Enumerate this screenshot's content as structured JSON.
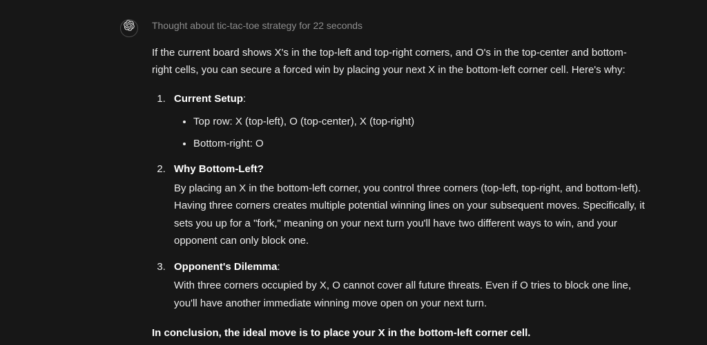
{
  "assistant": {
    "thought_label": "Thought about tic-tac-toe strategy for 22 seconds",
    "intro": "If the current board shows X's in the top-left and top-right corners, and O's in the top-center and bottom-right cells, you can secure a forced win by placing your next X in the bottom-left corner cell. Here's why:",
    "list": {
      "item1": {
        "title": "Current Setup",
        "bullets": {
          "b1": "Top row: X (top-left), O (top-center), X (top-right)",
          "b2": "Bottom-right: O"
        }
      },
      "item2": {
        "title": "Why Bottom-Left?",
        "body": "By placing an X in the bottom-left corner, you control three corners (top-left, top-right, and bottom-left). Having three corners creates multiple potential winning lines on your subsequent moves. Specifically, it sets you up for a \"fork,\" meaning on your next turn you'll have two different ways to win, and your opponent can only block one."
      },
      "item3": {
        "title": "Opponent's Dilemma",
        "body": "With three corners occupied by X, O cannot cover all future threats. Even if O tries to block one line, you'll have another immediate winning move open on your next turn."
      }
    },
    "conclusion": "In conclusion, the ideal move is to place your X in the bottom-left corner cell."
  }
}
